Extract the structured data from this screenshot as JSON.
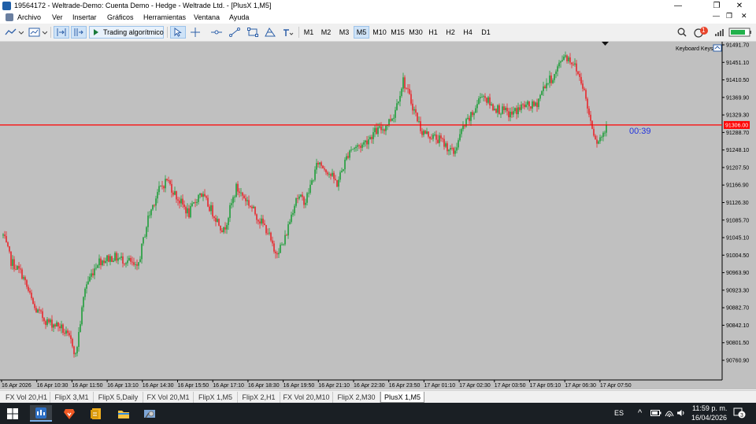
{
  "window": {
    "title": "19564172 - Weltrade-Demo: Cuenta Demo - Hedge - Weltrade Ltd. - [PlusX 1,M5]",
    "controls": [
      "—",
      "❐",
      "✕"
    ]
  },
  "menu": [
    "Archivo",
    "Ver",
    "Insertar",
    "Gráficos",
    "Herramientas",
    "Ventana",
    "Ayuda"
  ],
  "toolbar": {
    "algo_label": "Trading algorítmico",
    "timeframes": [
      "M1",
      "M2",
      "M3",
      "M5",
      "M10",
      "M15",
      "M30",
      "H1",
      "H2",
      "H4",
      "D1"
    ],
    "active_timeframe": "M5",
    "notification_count": "1"
  },
  "chart": {
    "keyboard_keys": "Keyboard Keys",
    "countdown": "00:39",
    "current_price": "91306.00",
    "y_ticks": [
      "91491.70",
      "91451.10",
      "91410.50",
      "91369.90",
      "91329.30",
      "91288.70",
      "91248.10",
      "91207.50",
      "91166.90",
      "91126.30",
      "91085.70",
      "91045.10",
      "91004.50",
      "90963.90",
      "90923.30",
      "90882.70",
      "90842.10",
      "90801.50",
      "90760.90"
    ],
    "x_ticks": [
      "16 Apr 2026",
      "16 Apr 10:30",
      "16 Apr 11:50",
      "16 Apr 13:10",
      "16 Apr 14:30",
      "16 Apr 15:50",
      "16 Apr 17:10",
      "16 Apr 18:30",
      "16 Apr 19:50",
      "16 Apr 21:10",
      "16 Apr 22:30",
      "16 Apr 23:50",
      "17 Apr 01:10",
      "17 Apr 02:30",
      "17 Apr 03:50",
      "17 Apr 05:10",
      "17 Apr 06:30",
      "17 Apr 07:50"
    ],
    "colors": {
      "background": "#c0c0c0",
      "bull": "#1e9e3a",
      "bear": "#e8262a",
      "price_line": "#ff0000",
      "countdown": "#2233dd"
    }
  },
  "chart_data": {
    "type": "candlestick",
    "symbol": "PlusX 1",
    "timeframe": "M5",
    "ylim": [
      90740,
      91510
    ],
    "current_price": 91306.0,
    "path_keypoints": [
      [
        0,
        91050
      ],
      [
        5,
        90990
      ],
      [
        12,
        90960
      ],
      [
        20,
        90880
      ],
      [
        28,
        90850
      ],
      [
        36,
        90840
      ],
      [
        44,
        90800
      ],
      [
        46,
        90770
      ],
      [
        52,
        90930
      ],
      [
        60,
        90990
      ],
      [
        70,
        91000
      ],
      [
        80,
        90990
      ],
      [
        85,
        90970
      ],
      [
        92,
        91090
      ],
      [
        98,
        91150
      ],
      [
        104,
        91180
      ],
      [
        110,
        91140
      ],
      [
        118,
        91100
      ],
      [
        125,
        91150
      ],
      [
        132,
        91110
      ],
      [
        140,
        91060
      ],
      [
        148,
        91160
      ],
      [
        155,
        91130
      ],
      [
        162,
        91090
      ],
      [
        168,
        91060
      ],
      [
        172,
        91010
      ],
      [
        178,
        91030
      ],
      [
        186,
        91140
      ],
      [
        192,
        91130
      ],
      [
        200,
        91220
      ],
      [
        206,
        91200
      ],
      [
        212,
        91170
      ],
      [
        220,
        91250
      ],
      [
        228,
        91260
      ],
      [
        236,
        91290
      ],
      [
        242,
        91300
      ],
      [
        248,
        91330
      ],
      [
        254,
        91410
      ],
      [
        260,
        91350
      ],
      [
        266,
        91290
      ],
      [
        272,
        91280
      ],
      [
        278,
        91270
      ],
      [
        286,
        91240
      ],
      [
        292,
        91300
      ],
      [
        298,
        91330
      ],
      [
        304,
        91380
      ],
      [
        310,
        91350
      ],
      [
        316,
        91340
      ],
      [
        322,
        91330
      ],
      [
        330,
        91350
      ],
      [
        338,
        91350
      ],
      [
        344,
        91400
      ],
      [
        350,
        91420
      ],
      [
        356,
        91470
      ],
      [
        362,
        91450
      ],
      [
        368,
        91400
      ],
      [
        372,
        91330
      ],
      [
        375,
        91290
      ],
      [
        377,
        91270
      ],
      [
        380,
        91280
      ],
      [
        383,
        91300
      ]
    ],
    "countdown": "00:39"
  }
}
